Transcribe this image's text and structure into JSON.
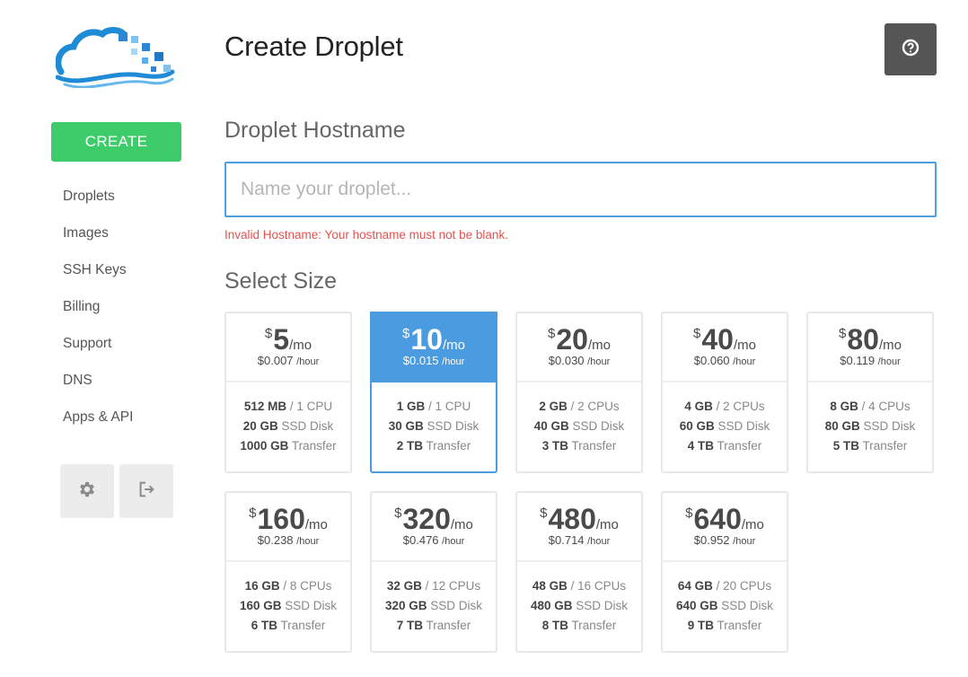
{
  "sidebar": {
    "create_label": "CREATE",
    "nav": [
      "Droplets",
      "Images",
      "SSH Keys",
      "Billing",
      "Support",
      "DNS",
      "Apps & API"
    ]
  },
  "header": {
    "title": "Create Droplet"
  },
  "hostname": {
    "section_title": "Droplet Hostname",
    "placeholder": "Name your droplet...",
    "value": "",
    "error": "Invalid Hostname: Your hostname must not be blank."
  },
  "size": {
    "section_title": "Select Size",
    "selected_index": 1,
    "plans": [
      {
        "currency": "$",
        "price": "5",
        "per": "/mo",
        "hourly": "$0.007",
        "hour_unit": "/hour",
        "ram": "512 MB",
        "cpu": "/ 1 CPU",
        "disk": "20 GB",
        "disk_label": "SSD Disk",
        "transfer": "1000 GB",
        "transfer_label": "Transfer"
      },
      {
        "currency": "$",
        "price": "10",
        "per": "/mo",
        "hourly": "$0.015",
        "hour_unit": "/hour",
        "ram": "1 GB",
        "cpu": "/ 1 CPU",
        "disk": "30 GB",
        "disk_label": "SSD Disk",
        "transfer": "2 TB",
        "transfer_label": "Transfer"
      },
      {
        "currency": "$",
        "price": "20",
        "per": "/mo",
        "hourly": "$0.030",
        "hour_unit": "/hour",
        "ram": "2 GB",
        "cpu": "/ 2 CPUs",
        "disk": "40 GB",
        "disk_label": "SSD Disk",
        "transfer": "3 TB",
        "transfer_label": "Transfer"
      },
      {
        "currency": "$",
        "price": "40",
        "per": "/mo",
        "hourly": "$0.060",
        "hour_unit": "/hour",
        "ram": "4 GB",
        "cpu": "/ 2 CPUs",
        "disk": "60 GB",
        "disk_label": "SSD Disk",
        "transfer": "4 TB",
        "transfer_label": "Transfer"
      },
      {
        "currency": "$",
        "price": "80",
        "per": "/mo",
        "hourly": "$0.119",
        "hour_unit": "/hour",
        "ram": "8 GB",
        "cpu": "/ 4 CPUs",
        "disk": "80 GB",
        "disk_label": "SSD Disk",
        "transfer": "5 TB",
        "transfer_label": "Transfer"
      },
      {
        "currency": "$",
        "price": "160",
        "per": "/mo",
        "hourly": "$0.238",
        "hour_unit": "/hour",
        "ram": "16 GB",
        "cpu": "/ 8 CPUs",
        "disk": "160 GB",
        "disk_label": "SSD Disk",
        "transfer": "6 TB",
        "transfer_label": "Transfer"
      },
      {
        "currency": "$",
        "price": "320",
        "per": "/mo",
        "hourly": "$0.476",
        "hour_unit": "/hour",
        "ram": "32 GB",
        "cpu": "/ 12 CPUs",
        "disk": "320 GB",
        "disk_label": "SSD Disk",
        "transfer": "7 TB",
        "transfer_label": "Transfer"
      },
      {
        "currency": "$",
        "price": "480",
        "per": "/mo",
        "hourly": "$0.714",
        "hour_unit": "/hour",
        "ram": "48 GB",
        "cpu": "/ 16 CPUs",
        "disk": "480 GB",
        "disk_label": "SSD Disk",
        "transfer": "8 TB",
        "transfer_label": "Transfer"
      },
      {
        "currency": "$",
        "price": "640",
        "per": "/mo",
        "hourly": "$0.952",
        "hour_unit": "/hour",
        "ram": "64 GB",
        "cpu": "/ 20 CPUs",
        "disk": "640 GB",
        "disk_label": "SSD Disk",
        "transfer": "9 TB",
        "transfer_label": "Transfer"
      }
    ]
  },
  "icons": {
    "logo": "cloud-logo-icon",
    "help": "question-circle-icon",
    "settings": "gear-icon",
    "logout": "sign-out-icon"
  },
  "colors": {
    "create": "#3ecb6a",
    "accent": "#4a9be0",
    "error": "#e5524e",
    "help_bg": "#555555",
    "logo_blue": "#1f8ad6"
  }
}
